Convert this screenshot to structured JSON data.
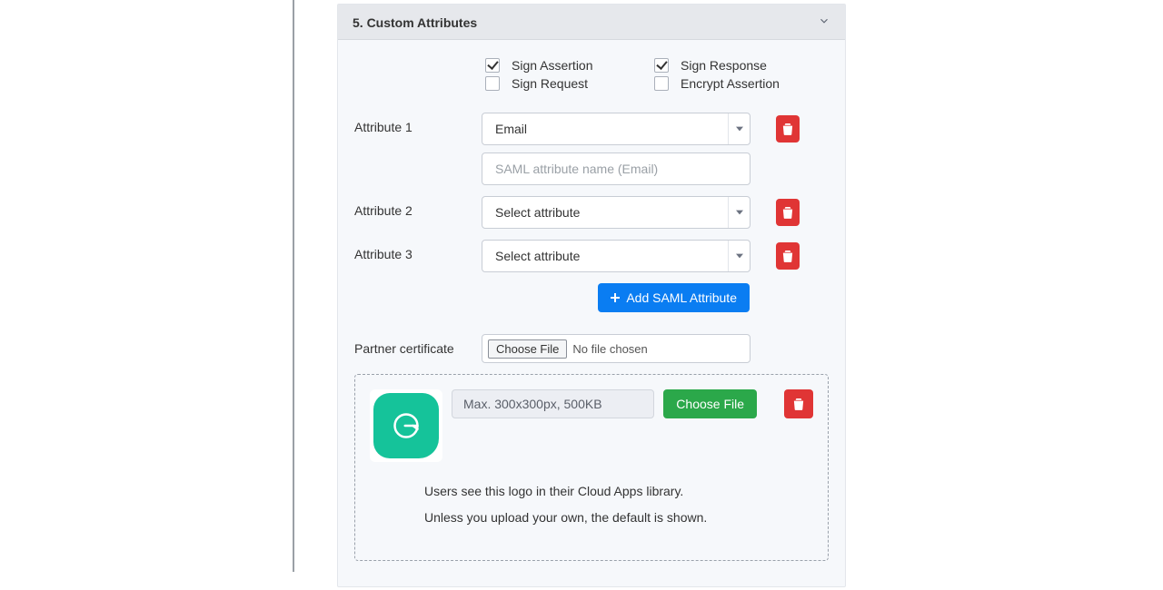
{
  "section": {
    "title": "5. Custom Attributes"
  },
  "checks": {
    "sign_assertion": "Sign Assertion",
    "sign_request": "Sign Request",
    "sign_response": "Sign Response",
    "encrypt_assertion": "Encrypt Assertion"
  },
  "attributes": [
    {
      "label": "Attribute 1",
      "select": "Email",
      "placeholder": "SAML attribute name (Email)"
    },
    {
      "label": "Attribute 2",
      "select": "Select attribute"
    },
    {
      "label": "Attribute 3",
      "select": "Select attribute"
    }
  ],
  "add_attribute_label": "Add SAML Attribute",
  "partner_cert": {
    "label": "Partner certificate",
    "button": "Choose File",
    "file": "No file chosen"
  },
  "logo": {
    "size_hint": "Max. 300x300px, 500KB",
    "choose_file": "Choose File",
    "note1": "Users see this logo in their Cloud Apps library.",
    "note2": "Unless you upload your own, the default is shown."
  }
}
